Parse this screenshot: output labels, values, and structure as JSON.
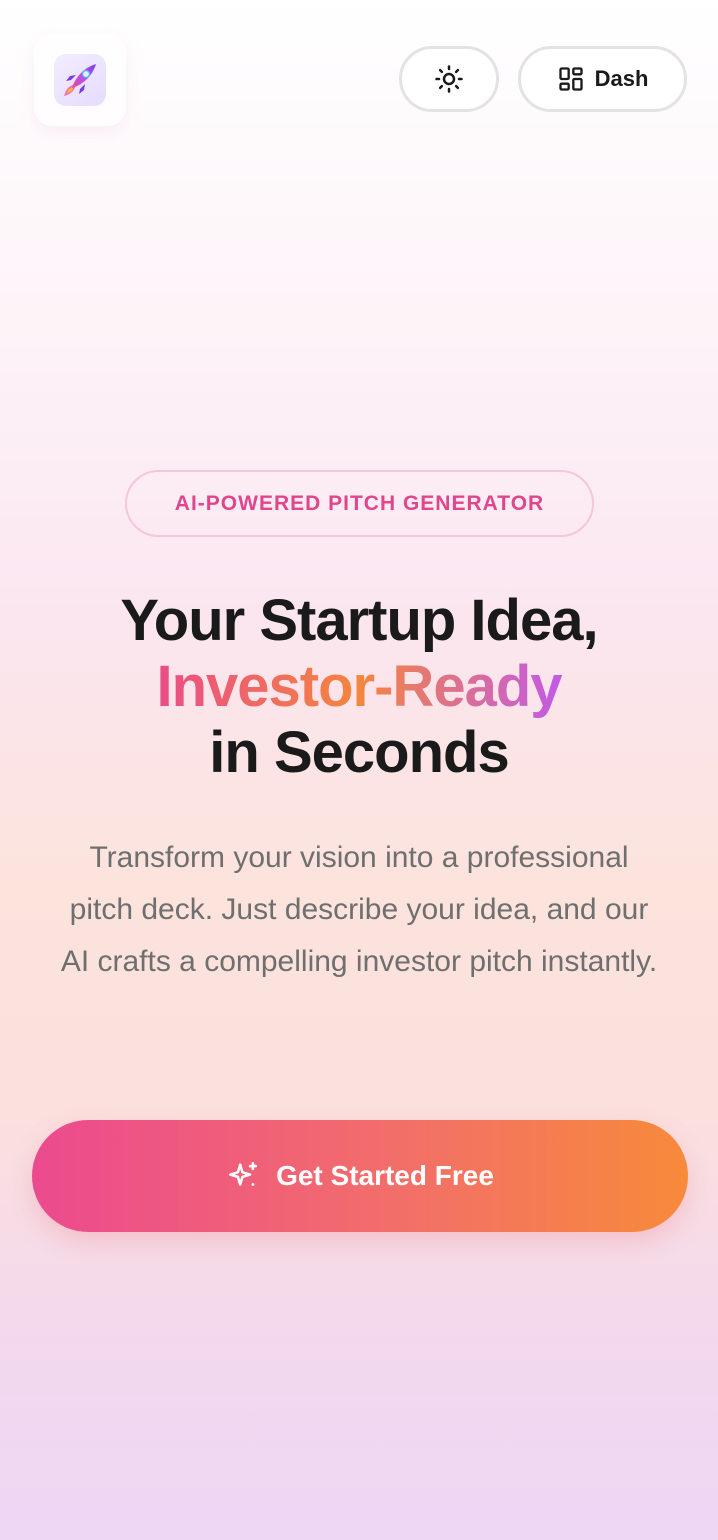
{
  "header": {
    "logo_icon": "rocket-icon",
    "theme_toggle_icon": "sun-icon",
    "dash_button": {
      "icon": "dashboard-grid-icon",
      "label": "Dash"
    }
  },
  "hero": {
    "badge": "AI-POWERED PITCH GENERATOR",
    "headline": {
      "line1": "Your Startup Idea,",
      "line2": "Investor-Ready",
      "line3": "in Seconds"
    },
    "subtext": "Transform your vision into a professional pitch deck. Just describe your idea, and our AI crafts a compelling investor pitch instantly.",
    "cta": {
      "icon": "sparkle-icon",
      "label": "Get Started Free"
    }
  },
  "colors": {
    "accent_pink": "#ea4c89",
    "accent_orange": "#f4863e",
    "accent_purple": "#c25ae6",
    "badge_text": "#e0468c",
    "heading": "#1a1a1a",
    "body_text": "#6f6f6f"
  }
}
